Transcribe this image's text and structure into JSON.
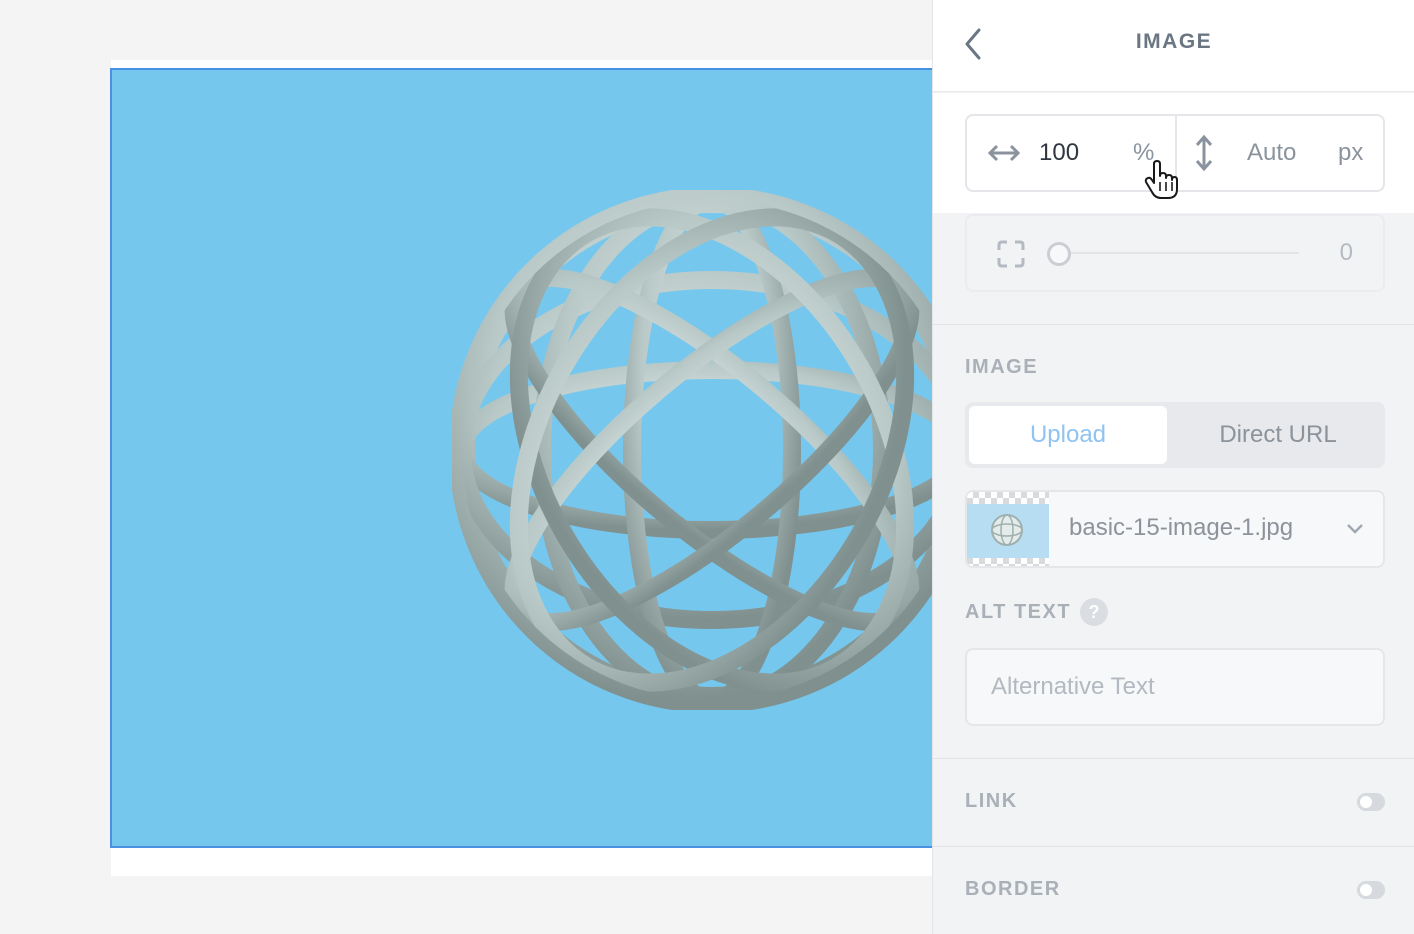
{
  "sidebar": {
    "title": "IMAGE",
    "size": {
      "width_value": "100",
      "width_unit": "%",
      "height_value": "Auto",
      "height_unit": "px"
    },
    "radius": {
      "value": "0"
    },
    "image_section": {
      "label": "IMAGE",
      "tabs": [
        {
          "label": "Upload",
          "active": true
        },
        {
          "label": "Direct URL",
          "active": false
        }
      ],
      "file_name": "basic-15-image-1.jpg"
    },
    "alt_text": {
      "label": "ALT TEXT",
      "help": "?",
      "placeholder": "Alternative Text"
    },
    "link": {
      "label": "LINK",
      "enabled": false
    },
    "border": {
      "label": "BORDER",
      "enabled": false
    }
  },
  "colors": {
    "image_background": "#76c7ee",
    "selection_border": "#4a90e2",
    "active_tab_text": "#8fc3f2"
  },
  "icons": [
    "back-arrow-icon",
    "horizontal-resize-icon",
    "vertical-resize-icon",
    "corner-radius-icon",
    "chevron-down-icon",
    "help-icon",
    "hand-pointer-cursor"
  ]
}
